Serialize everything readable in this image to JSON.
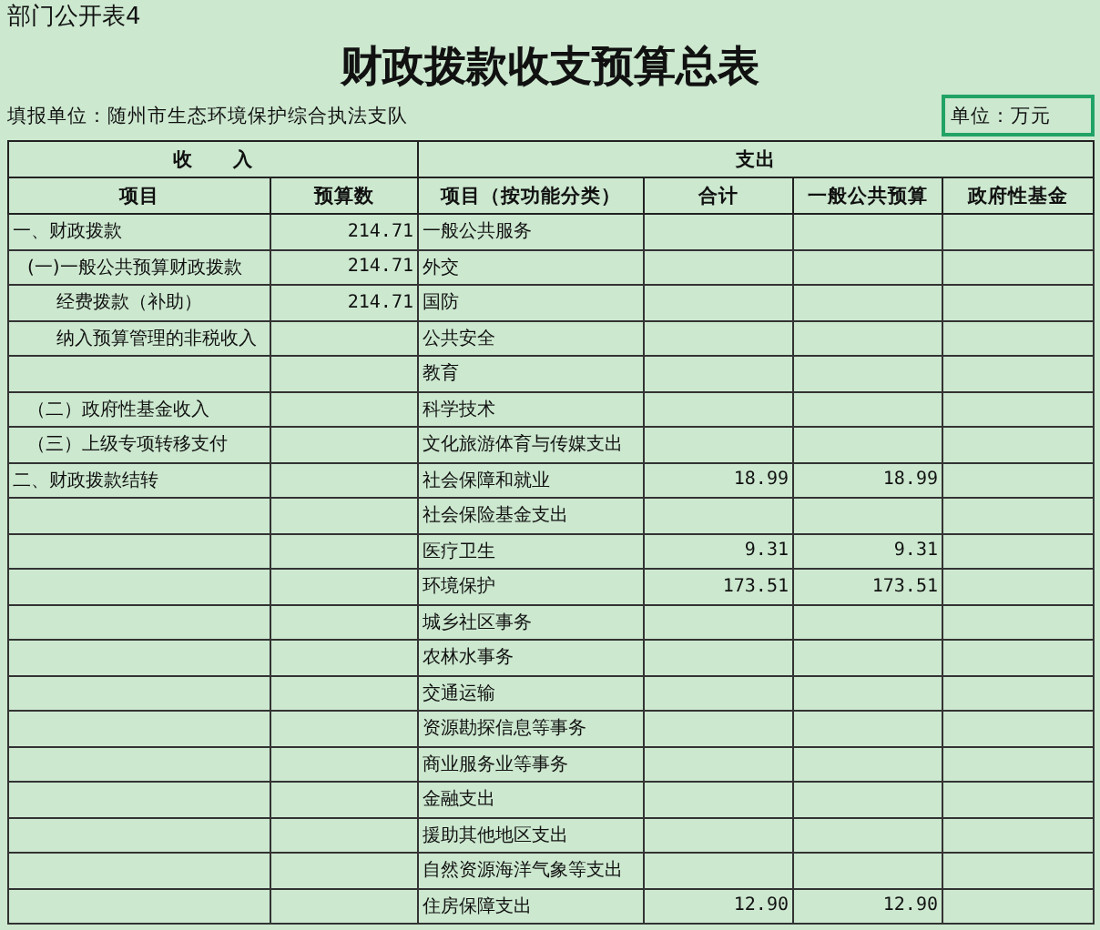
{
  "sheet_label": "部门公开表4",
  "title": "财政拨款收支预算总表",
  "reporting_unit": "填报单位：随州市生态环境保护综合执法支队",
  "unit": {
    "text": "单位：万元",
    "selected": true
  },
  "group_headers": {
    "income": "收　　入",
    "expense": "支出"
  },
  "columns": [
    "项目",
    "预算数",
    "项目（按功能分类）",
    "合计",
    "一般公共预算",
    "政府性基金"
  ],
  "income": [
    {
      "label": "一、财政拨款",
      "amount": "214.71",
      "children": [
        {
          "label": "(一)一般公共预算财政拨款",
          "amount": "214.71",
          "children": [
            {
              "label": "经费拨款（补助）",
              "amount": "214.71"
            },
            {
              "label": "纳入预算管理的非税收入"
            }
          ]
        },
        {
          "label": "（二）政府性基金收入",
          "gap_before": true
        },
        {
          "label": "（三）上级专项转移支付"
        }
      ]
    },
    {
      "label": "二、财政拨款结转"
    }
  ],
  "expense": [
    {
      "item": "一般公共服务"
    },
    {
      "item": "外交"
    },
    {
      "item": "国防"
    },
    {
      "item": "公共安全"
    },
    {
      "item": "教育"
    },
    {
      "item": "科学技术"
    },
    {
      "item": "文化旅游体育与传媒支出"
    },
    {
      "item": "社会保障和就业",
      "total": "18.99",
      "general": "18.99"
    },
    {
      "item": "社会保险基金支出"
    },
    {
      "item": "医疗卫生",
      "total": "9.31",
      "general": "9.31"
    },
    {
      "item": "环境保护",
      "total": "173.51",
      "general": "173.51"
    },
    {
      "item": "城乡社区事务"
    },
    {
      "item": "农林水事务"
    },
    {
      "item": "交通运输"
    },
    {
      "item": "资源勘探信息等事务"
    },
    {
      "item": "商业服务业等事务"
    },
    {
      "item": "金融支出"
    },
    {
      "item": "援助其他地区支出"
    },
    {
      "item": "自然资源海洋气象等支出"
    },
    {
      "item": "住房保障支出",
      "total": "12.90",
      "general": "12.90"
    }
  ]
}
